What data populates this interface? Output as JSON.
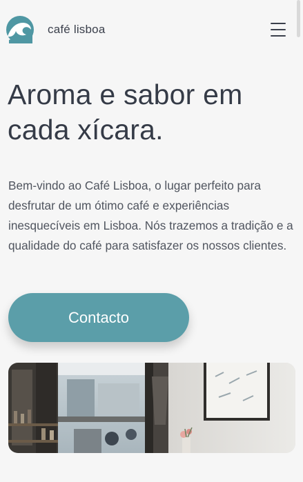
{
  "header": {
    "brand": "café lisboa",
    "logo_icon": "wave-logo-icon",
    "menu_icon": "hamburger-menu-icon"
  },
  "hero": {
    "title": "Aroma e sabor em cada xícara.",
    "description": "Bem-vindo ao Café Lisboa, o lugar perfeito para desfrutar de um ótimo café e experiências inesquecíveis em Lisboa. Nós trazemos a tradição e a qualidade do café para satisfazer os nossos clientes.",
    "cta_label": "Contacto"
  },
  "colors": {
    "accent": "#5b9ea9",
    "background": "#f6f6f6",
    "text": "#353b47"
  }
}
